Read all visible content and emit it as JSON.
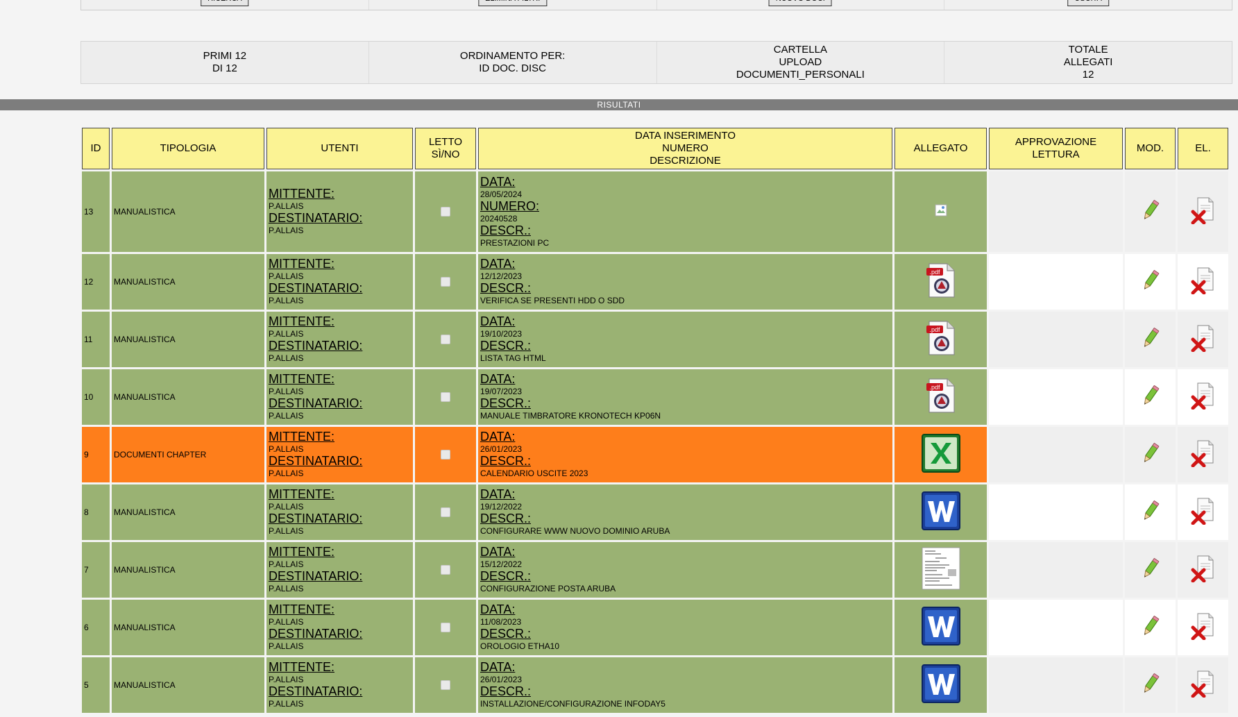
{
  "toolbar": {
    "buttons": [
      "RICERCA",
      "ELIMINA FILTRI",
      "NUOVO DOC.",
      "USCITA"
    ]
  },
  "info": {
    "count_line1": "PRIMI 12",
    "count_line2": "DI 12",
    "order_line1": "ORDINAMENTO PER:",
    "order_line2": "ID DOC. DISC",
    "folder_line1": "CARTELLA",
    "folder_line2": "UPLOAD",
    "folder_line3": "DOCUMENTI_PERSONALI",
    "total_line1": "TOTALE",
    "total_line2": "ALLEGATI",
    "total_line3": "12"
  },
  "band_label": "RISULTATI",
  "headers": {
    "id": "ID",
    "tipologia": "TIPOLOGIA",
    "utenti": "UTENTI",
    "letto_1": "LETTO",
    "letto_2": "SÌ/NO",
    "data_1": "DATA INSERIMENTO",
    "data_2": "NUMERO",
    "data_3": "DESCRIZIONE",
    "allegato": "ALLEGATO",
    "appr_1": "APPROVAZIONE",
    "appr_2": "LETTURA",
    "mod": "MOD.",
    "el": "EL."
  },
  "labels": {
    "mittente": "MITTENTE:",
    "destinatario": "DESTINATARIO:",
    "data": "DATA:",
    "numero": "NUMERO:",
    "descr": "DESCR.:"
  },
  "colors": {
    "row_green": "#9ab273",
    "row_orange": "#fe7e1b",
    "header_yellow": "#fbf394",
    "band_gray": "#7d7d7d"
  },
  "rows": [
    {
      "id": "13",
      "tipologia": "MANUALISTICA",
      "mittente": "P.ALLAIS",
      "destinatario": "P.ALLAIS",
      "data": "28/05/2024",
      "numero": "20240528",
      "descr": "PRESTAZIONI PC",
      "allegato": "broken-image-icon",
      "color": "green"
    },
    {
      "id": "12",
      "tipologia": "MANUALISTICA",
      "mittente": "P.ALLAIS",
      "destinatario": "P.ALLAIS",
      "data": "12/12/2023",
      "numero": "",
      "descr": "VERIFICA SE PRESENTI HDD O SDD",
      "allegato": "pdf-icon",
      "color": "green"
    },
    {
      "id": "11",
      "tipologia": "MANUALISTICA",
      "mittente": "P.ALLAIS",
      "destinatario": "P.ALLAIS",
      "data": "19/10/2023",
      "numero": "",
      "descr": "LISTA TAG HTML",
      "allegato": "pdf-icon",
      "color": "green"
    },
    {
      "id": "10",
      "tipologia": "MANUALISTICA",
      "mittente": "P.ALLAIS",
      "destinatario": "P.ALLAIS",
      "data": "19/07/2023",
      "numero": "",
      "descr": "MANUALE TIMBRATORE KRONOTECH KP06N",
      "allegato": "pdf-icon",
      "color": "green"
    },
    {
      "id": "9",
      "tipologia": "DOCUMENTI CHAPTER",
      "mittente": "P.ALLAIS",
      "destinatario": "P.ALLAIS",
      "data": "26/01/2023",
      "numero": "",
      "descr": "CALENDARIO USCITE 2023",
      "allegato": "excel-icon",
      "color": "orange"
    },
    {
      "id": "8",
      "tipologia": "MANUALISTICA",
      "mittente": "P.ALLAIS",
      "destinatario": "P.ALLAIS",
      "data": "19/12/2022",
      "numero": "",
      "descr": "CONFIGURARE WWW NUOVO DOMINIO ARUBA",
      "allegato": "word-icon",
      "color": "green"
    },
    {
      "id": "7",
      "tipologia": "MANUALISTICA",
      "mittente": "P.ALLAIS",
      "destinatario": "P.ALLAIS",
      "data": "15/12/2022",
      "numero": "",
      "descr": "CONFIGURAZIONE POSTA ARUBA",
      "allegato": "document-thumbnail-icon",
      "color": "green"
    },
    {
      "id": "6",
      "tipologia": "MANUALISTICA",
      "mittente": "P.ALLAIS",
      "destinatario": "P.ALLAIS",
      "data": "11/08/2023",
      "numero": "",
      "descr": "OROLOGIO ETHA10",
      "allegato": "word-icon",
      "color": "green"
    },
    {
      "id": "5",
      "tipologia": "MANUALISTICA",
      "mittente": "P.ALLAIS",
      "destinatario": "P.ALLAIS",
      "data": "26/01/2023",
      "numero": "",
      "descr": "INSTALLAZIONE/CONFIGURAZIONE INFODAY5",
      "allegato": "word-icon",
      "color": "green"
    }
  ]
}
